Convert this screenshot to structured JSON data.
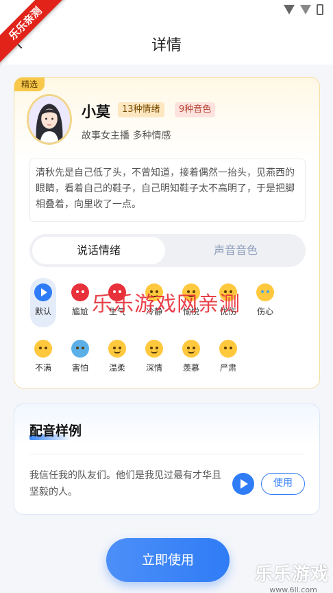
{
  "status_bar": {
    "icons": [
      "wifi-icon",
      "signal-icon",
      "battery-icon"
    ]
  },
  "nav": {
    "title": "详情",
    "back_icon": "chevron-left-icon"
  },
  "watermark": {
    "corner": "乐乐亲测",
    "center": "乐乐游戏网亲测",
    "bottom_brand": "乐乐游戏",
    "bottom_url": "www.6ll.com"
  },
  "voice": {
    "badge": "精选",
    "name": "小莫",
    "emotion_tag": "13种情绪",
    "tone_tag": "9种音色",
    "subtitle": "故事女主播 多种情感",
    "quote": "清秋先是自己低了头，不曾知道，接着偶然一抬头，见燕西的眼睛，看着自己的鞋子，自己明知鞋子太不高明了，于是把脚相叠着，向里收了一点。"
  },
  "tabs": {
    "active": "说话情绪",
    "inactive": "声音音色"
  },
  "emotions": [
    {
      "label": "默认",
      "icon": "play-icon"
    },
    {
      "label": "尴尬",
      "icon": "angry-face-icon"
    },
    {
      "label": "生气",
      "icon": "angry-face-icon"
    },
    {
      "label": "冷静",
      "icon": "calm-face-icon"
    },
    {
      "label": "愉悦",
      "icon": "happy-face-icon"
    },
    {
      "label": "忧伤",
      "icon": "sad-face-icon"
    },
    {
      "label": "伤心",
      "icon": "crying-face-icon"
    },
    {
      "label": "不满",
      "icon": "thinking-face-icon"
    },
    {
      "label": "害怕",
      "icon": "scared-face-icon"
    },
    {
      "label": "温柔",
      "icon": "smile-face-icon"
    },
    {
      "label": "深情",
      "icon": "smile-face-icon"
    },
    {
      "label": "羡慕",
      "icon": "smile-face-icon"
    },
    {
      "label": "严肃",
      "icon": "neutral-face-icon"
    }
  ],
  "sample": {
    "title": "配音样例",
    "text": "我信任我的队友们。他们是我见过最有才华且坚毅的人。",
    "use_label": "使用"
  },
  "cta": {
    "label": "立即使用"
  },
  "colors": {
    "accent": "#2f7cf6",
    "gold": "#f8c84c",
    "red": "#e2231a"
  }
}
